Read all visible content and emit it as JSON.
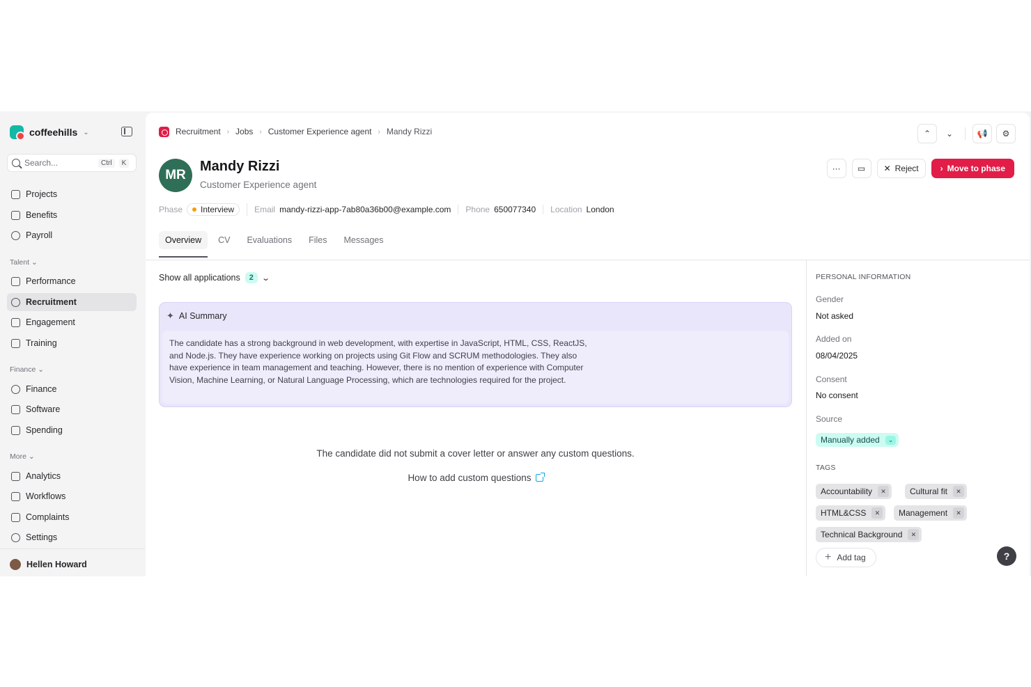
{
  "workspace": {
    "name": "coffeehills"
  },
  "search": {
    "placeholder": "Search...",
    "shortcut_ctrl": "Ctrl",
    "shortcut_key": "K"
  },
  "sidebar": {
    "top_items": [
      {
        "label": "Projects",
        "icon": "briefcase-icon"
      },
      {
        "label": "Benefits",
        "icon": "gift-icon"
      },
      {
        "label": "Payroll",
        "icon": "coin-icon"
      }
    ],
    "sections": [
      {
        "label": "Talent",
        "items": [
          {
            "label": "Performance",
            "icon": "chart-line-icon"
          },
          {
            "label": "Recruitment",
            "icon": "recruitment-icon",
            "active": true
          },
          {
            "label": "Engagement",
            "icon": "chat-icon"
          },
          {
            "label": "Training",
            "icon": "book-icon"
          }
        ]
      },
      {
        "label": "Finance",
        "items": [
          {
            "label": "Finance",
            "icon": "money-icon"
          },
          {
            "label": "Software",
            "icon": "software-icon"
          },
          {
            "label": "Spending",
            "icon": "card-icon"
          }
        ]
      },
      {
        "label": "More",
        "items": [
          {
            "label": "Analytics",
            "icon": "analytics-icon"
          },
          {
            "label": "Workflows",
            "icon": "workflow-icon"
          },
          {
            "label": "Complaints",
            "icon": "complaint-icon"
          },
          {
            "label": "Settings",
            "icon": "gear-icon"
          }
        ]
      }
    ],
    "user": {
      "name": "Hellen Howard"
    }
  },
  "breadcrumb": [
    "Recruitment",
    "Jobs",
    "Customer Experience agent",
    "Mandy Rizzi"
  ],
  "candidate": {
    "initials": "MR",
    "name": "Mandy Rizzi",
    "role": "Customer Experience agent",
    "phase_label": "Phase",
    "phase": "Interview",
    "email_label": "Email",
    "email": "mandy-rizzi-app-7ab80a36b00@example.com",
    "phone_label": "Phone",
    "phone": "650077340",
    "location_label": "Location",
    "location": "London"
  },
  "actions": {
    "more": "···",
    "reject": "Reject",
    "move": "Move to phase"
  },
  "tabs": [
    "Overview",
    "CV",
    "Evaluations",
    "Files",
    "Messages"
  ],
  "applications": {
    "label": "Show all applications",
    "count": "2"
  },
  "ai_summary": {
    "title": "AI Summary",
    "text": "The candidate has a strong background in web development, with expertise in JavaScript, HTML, CSS, ReactJS, and Node.js. They have experience working on projects using Git Flow and SCRUM methodologies. They also have experience in team management and teaching. However, there is no mention of experience with Computer Vision, Machine Learning, or Natural Language Processing, which are technologies required for the project."
  },
  "empty_note": "The candidate did not submit a cover letter or answer any custom questions.",
  "help_link": "How to add custom questions",
  "personal_info": {
    "section": "PERSONAL INFORMATION",
    "gender_label": "Gender",
    "gender": "Not asked",
    "added_label": "Added on",
    "added": "08/04/2025",
    "consent_label": "Consent",
    "consent": "No consent",
    "source_label": "Source",
    "source": "Manually added"
  },
  "tags": {
    "section": "TAGS",
    "items": [
      "Accountability",
      "Cultural fit",
      "HTML&CSS",
      "Management",
      "Technical Background"
    ],
    "add_label": "Add tag"
  },
  "help": "?",
  "colors": {
    "primary": "#e11d48",
    "teal": "#14b8a6",
    "ai_bg": "#e9e6fb",
    "avatar": "#2f6f57"
  }
}
